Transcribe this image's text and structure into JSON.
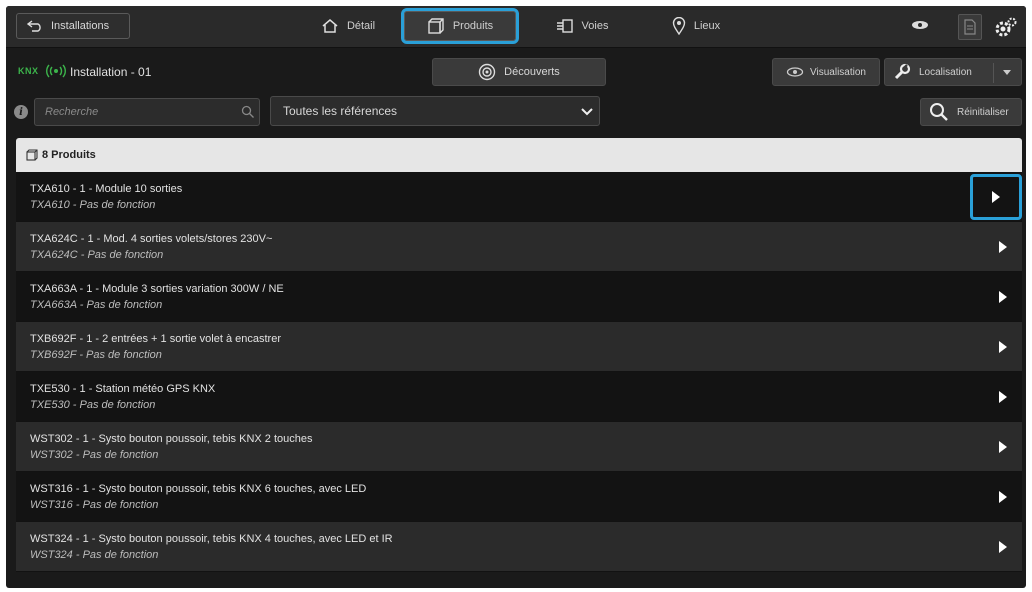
{
  "topbar": {
    "back_label": "Installations",
    "tabs": [
      {
        "label": "Détail",
        "icon": "home-icon"
      },
      {
        "label": "Produits",
        "icon": "box-icon",
        "active": true
      },
      {
        "label": "Voies",
        "icon": "channels-icon"
      },
      {
        "label": "Lieux",
        "icon": "location-pin-icon"
      }
    ]
  },
  "installation": {
    "logo_text": "KNX",
    "name": "Installation - 01",
    "discover_label": "Découverts",
    "visualisation_label": "Visualisation",
    "localisation_label": "Localisation"
  },
  "filters": {
    "search_placeholder": "Recherche",
    "reference_select": "Toutes les références",
    "reset_label": "Réinitialiser"
  },
  "list": {
    "header": "8 Produits",
    "items": [
      {
        "title": "TXA610 - 1 - Module 10 sorties",
        "sub": "TXA610 - Pas de fonction"
      },
      {
        "title": "TXA624C - 1 - Mod. 4 sorties volets/stores 230V~",
        "sub": "TXA624C - Pas de fonction"
      },
      {
        "title": "TXA663A - 1 - Module 3 sorties variation 300W / NE",
        "sub": "TXA663A - Pas de fonction"
      },
      {
        "title": "TXB692F - 1 - 2 entrées + 1 sortie volet à encastrer",
        "sub": "TXB692F - Pas de fonction"
      },
      {
        "title": "TXE530 - 1 - Station météo GPS KNX",
        "sub": "TXE530 - Pas de fonction"
      },
      {
        "title": "WST302 - 1 - Systo bouton poussoir, tebis KNX 2 touches",
        "sub": "WST302 - Pas de fonction"
      },
      {
        "title": "WST316 - 1 - Systo bouton poussoir, tebis KNX 6 touches, avec LED",
        "sub": "WST316 - Pas de fonction"
      },
      {
        "title": "WST324 - 1 - Systo bouton poussoir, tebis KNX 4 touches, avec LED et IR",
        "sub": "WST324 - Pas de fonction"
      }
    ]
  },
  "colors": {
    "accent": "#2aa0d8",
    "knx_green": "#3cb44b"
  }
}
